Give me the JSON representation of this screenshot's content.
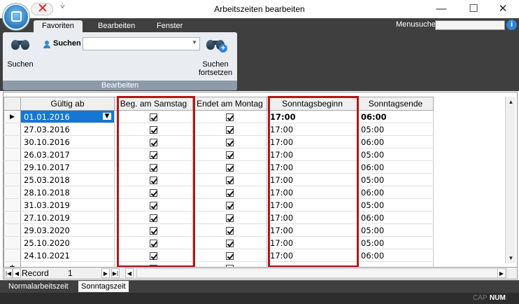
{
  "window": {
    "title": "Arbeitszeiten bearbeiten",
    "minimize": "—",
    "maximize": "☐",
    "close": "✕",
    "quick_access_arrow": "⩒"
  },
  "ribbon": {
    "tabs": [
      "Favoriten",
      "Bearbeiten",
      "Fenster"
    ],
    "active_tab": "Favoriten",
    "menusuche_label": "Menusuche",
    "menusuche_value": "",
    "group_label": "Bearbeiten",
    "suchen_big_label": "Suchen",
    "suchen_small_label": "Suchen",
    "suchen_combo_value": "",
    "suchen_fortsetzen_line1": "Suchen",
    "suchen_fortsetzen_line2": "fortsetzen"
  },
  "grid": {
    "columns": [
      "Gültig ab",
      "Beg. am Samstag",
      "Endet am Montag",
      "Sonntagsbeginn",
      "Sonntagsende"
    ],
    "rows": [
      {
        "gueltig_ab": "01.01.2016",
        "beg_samstag": true,
        "endet_montag": true,
        "beginn": "17:00",
        "ende": "06:00"
      },
      {
        "gueltig_ab": "27.03.2016",
        "beg_samstag": true,
        "endet_montag": true,
        "beginn": "17:00",
        "ende": "05:00"
      },
      {
        "gueltig_ab": "30.10.2016",
        "beg_samstag": true,
        "endet_montag": true,
        "beginn": "17:00",
        "ende": "06:00"
      },
      {
        "gueltig_ab": "26.03.2017",
        "beg_samstag": true,
        "endet_montag": true,
        "beginn": "17:00",
        "ende": "05:00"
      },
      {
        "gueltig_ab": "29.10.2017",
        "beg_samstag": true,
        "endet_montag": true,
        "beginn": "17:00",
        "ende": "06:00"
      },
      {
        "gueltig_ab": "25.03.2018",
        "beg_samstag": true,
        "endet_montag": true,
        "beginn": "17:00",
        "ende": "05:00"
      },
      {
        "gueltig_ab": "28.10.2018",
        "beg_samstag": true,
        "endet_montag": true,
        "beginn": "17:00",
        "ende": "06:00"
      },
      {
        "gueltig_ab": "31.03.2019",
        "beg_samstag": true,
        "endet_montag": true,
        "beginn": "17:00",
        "ende": "05:00"
      },
      {
        "gueltig_ab": "27.10.2019",
        "beg_samstag": true,
        "endet_montag": true,
        "beginn": "17:00",
        "ende": "06:00"
      },
      {
        "gueltig_ab": "29.03.2020",
        "beg_samstag": true,
        "endet_montag": true,
        "beginn": "17:00",
        "ende": "05:00"
      },
      {
        "gueltig_ab": "25.10.2020",
        "beg_samstag": true,
        "endet_montag": true,
        "beginn": "17:00",
        "ende": "05:00"
      },
      {
        "gueltig_ab": "24.10.2021",
        "beg_samstag": true,
        "endet_montag": true,
        "beginn": "17:00",
        "ende": "06:00"
      }
    ],
    "current_row_marker": "▶",
    "new_row_marker": "✱",
    "highlight_color": "#b01818",
    "selection_color": "#1477d4"
  },
  "navigation": {
    "record_label": "Record",
    "record_number": "1",
    "first": "|◀",
    "prev": "◀",
    "next": "▶",
    "last": "▶|",
    "scroll_left": "◀",
    "scroll_right": "▶"
  },
  "sheet_tabs": [
    "Normalarbeitszeit",
    "Sonntagszeit"
  ],
  "active_sheet": "Sonntagszeit",
  "status": {
    "cap": "CAP",
    "num": "NUM"
  }
}
